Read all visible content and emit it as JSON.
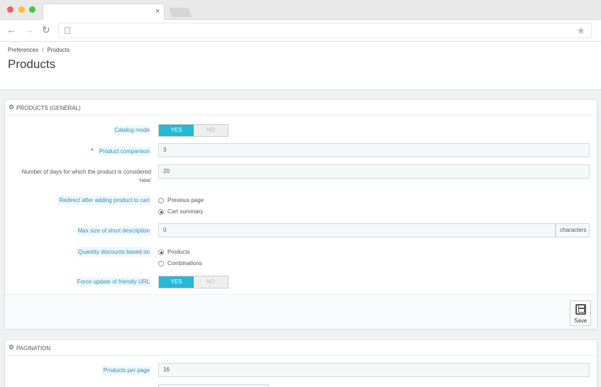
{
  "browser": {
    "tab_close": "×",
    "back_icon": "←",
    "forward_icon": "→",
    "reload_icon": "↻",
    "bookmark_icon": "★"
  },
  "header": {
    "breadcrumb": [
      "Preferences",
      "Products"
    ],
    "breadcrumb_separator": "/",
    "title": "Products"
  },
  "general": {
    "heading": "PRODUCTS (GENERAL)",
    "catalog_mode": {
      "label": "Catalog mode",
      "yes": "YES",
      "no": "NO",
      "value": "YES"
    },
    "product_comparison": {
      "label": "Product comparison",
      "required": "*",
      "value": "3"
    },
    "days_new": {
      "label_line1": "Number of days for which the product is considered",
      "label_line2": "'new'",
      "value": "20"
    },
    "redirect": {
      "label": "Redirect after adding product to cart",
      "options": [
        "Previous page",
        "Cart summary"
      ],
      "selected": "Cart summary"
    },
    "short_desc": {
      "label": "Max size of short description",
      "value": "0",
      "suffix": "characters"
    },
    "quantity_discounts": {
      "label": "Quantity discounts based on",
      "options": [
        "Products",
        "Combinations"
      ],
      "selected": "Products"
    },
    "friendly_url": {
      "label": "Force update of friendly URL",
      "yes": "YES",
      "no": "NO",
      "value": "YES"
    },
    "save_label": "Save"
  },
  "pagination": {
    "heading": "PAGINATION",
    "products_per_page": {
      "label": "Products per page",
      "value": "16"
    }
  },
  "colors": {
    "accent": "#25b9d7",
    "label_text": "#2d8fb9",
    "label_bg": "#eef7fb",
    "required": "#e33333"
  }
}
